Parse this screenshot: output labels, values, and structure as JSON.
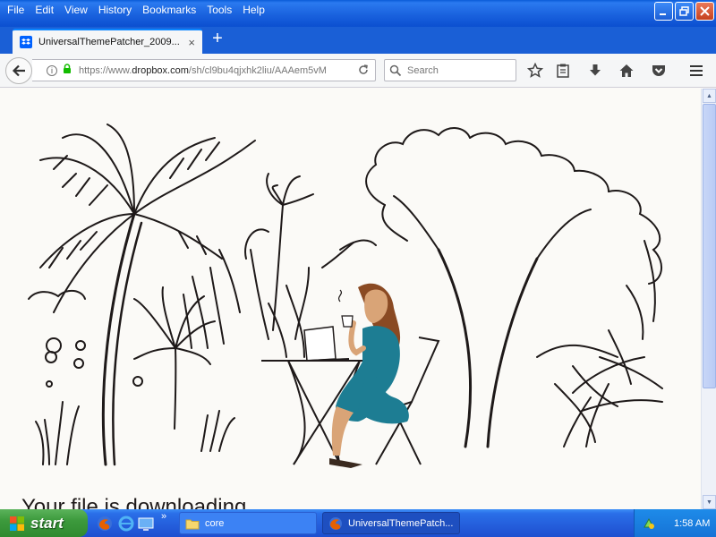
{
  "menu": [
    "File",
    "Edit",
    "View",
    "History",
    "Bookmarks",
    "Tools",
    "Help"
  ],
  "tab": {
    "title": "UniversalThemePatcher_2009...",
    "close": "×"
  },
  "new_tab": "+",
  "url": {
    "prefix": "https://www.",
    "domain": "dropbox.com",
    "rest": "/sh/cl9bu4qjxhk2liu/AAAem5vM"
  },
  "search": {
    "placeholder": "Search"
  },
  "content": {
    "heading": "Your file is downloading"
  },
  "taskbar": {
    "start": "start",
    "tasks": [
      "core",
      "UniversalThemePatch..."
    ],
    "clock": "1:58 AM"
  },
  "colors": {
    "dress": "#1d7d93",
    "hair": "#8a4a23",
    "accent": "#0061fe"
  }
}
